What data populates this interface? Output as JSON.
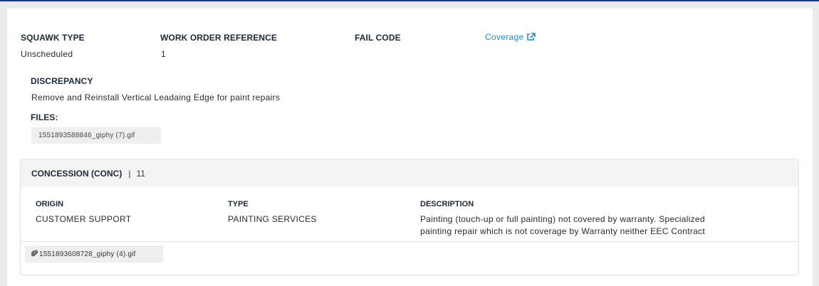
{
  "header": {
    "squawk_type_label": "SQUAWK TYPE",
    "squawk_type_value": "Unscheduled",
    "work_order_label": "WORK ORDER REFERENCE",
    "work_order_value": "1",
    "fail_code_label": "FAIL CODE",
    "coverage_link": "Coverage",
    "coverage_icon": "external-link-icon"
  },
  "discrepancy": {
    "label": "DISCREPANCY",
    "text": "Remove and Reinstall Vertical Leadaing Edge for paint repairs"
  },
  "files": {
    "label": "FILES:",
    "items": [
      "1551893588846_giphy (7).gif"
    ]
  },
  "concession": {
    "title": "CONCESSION (CONC)",
    "separator": "|",
    "count": "11",
    "origin_label": "ORIGIN",
    "origin_value": "CUSTOMER SUPPORT",
    "type_label": "TYPE",
    "type_value": "PAINTING SERVICES",
    "description_label": "DESCRIPTION",
    "description_line1": "Painting (touch-up or full painting) not covered by warranty. Specialized",
    "description_line2": "painting repair which is not coverage by Warranty neither EEC Contract",
    "attachment": "1551893608728_giphy (4).gif",
    "attachment_icon": "paperclip-icon"
  },
  "colors": {
    "accent": "#1b3a7a",
    "link": "#1a8fd1",
    "background": "#ebebeb"
  }
}
